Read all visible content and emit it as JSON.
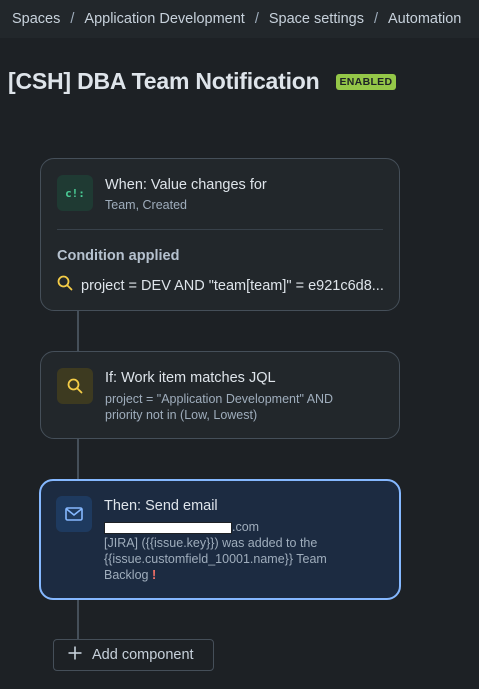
{
  "breadcrumbs": [
    "Spaces",
    "Application Development",
    "Space settings",
    "Automation"
  ],
  "breadcrumb_separator": "/",
  "page": {
    "title": "[CSH] DBA Team Notification",
    "status": "ENABLED",
    "status_color": "#94c748"
  },
  "trigger": {
    "icon": "value-changes-icon",
    "title": "When: Value changes for",
    "subtitle": "Team, Created",
    "condition_label": "Condition applied",
    "condition_icon": "search-icon",
    "condition_text": "project = DEV AND \"team[team]\" = e921c6d8..."
  },
  "condition": {
    "icon": "search-icon",
    "title": "If: Work item matches JQL",
    "line1": "project = \"Application Development\" AND",
    "line2": "priority not in (Low, Lowest)"
  },
  "action": {
    "icon": "email-icon",
    "title": "Then: Send email",
    "recipient_suffix": ".com",
    "line1": "[JIRA] ({{issue.key}}) was added to the",
    "line2": "{{issue.customfield_10001.name}} Team",
    "line3": "Backlog",
    "warning_icon": "exclamation-icon",
    "warning_glyph": "!"
  },
  "add_component": {
    "icon": "plus-icon",
    "label": "Add component"
  },
  "colors": {
    "background": "#1d2125",
    "card": "#22272b",
    "selected_border": "#85b8ff",
    "selected_card": "#1c2b41",
    "search_icon": "#f5cd47",
    "warning": "#f87168"
  }
}
